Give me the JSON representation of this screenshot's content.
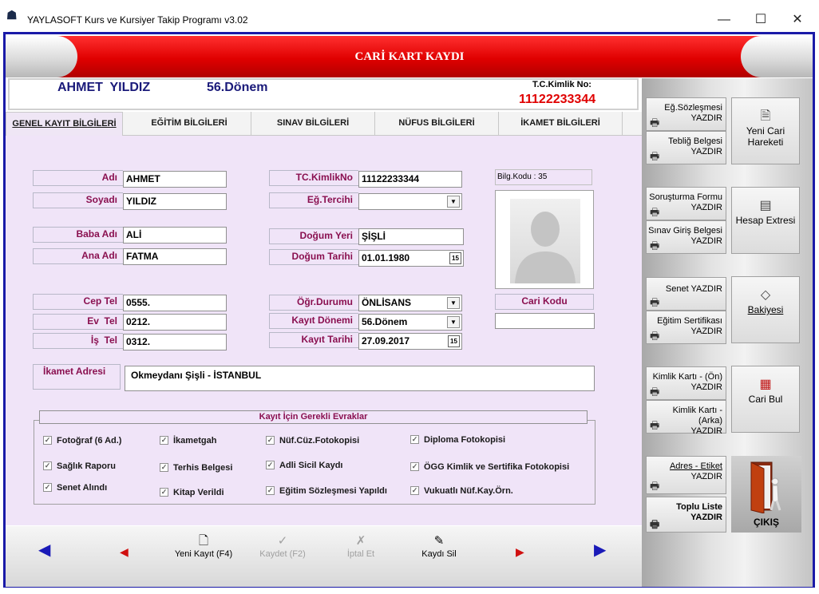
{
  "window": {
    "title": "YAYLASOFT Kurs ve Kursiyer Takip Programı v3.02",
    "minimize": "—",
    "maximize": "☐",
    "close": "✕"
  },
  "header": {
    "title": "CARİ KART KAYDI",
    "student_name": "AHMET  YILDIZ",
    "term": "56.Dönem",
    "tc_label": "T.C.Kimlik No:",
    "tc_value": "11122233344"
  },
  "tabs": [
    {
      "label": "GENEL KAYIT BİLGİLERİ"
    },
    {
      "label": "EĞİTİM BİLGİLERİ"
    },
    {
      "label": "SINAV BİLGİLERİ"
    },
    {
      "label": "NÜFUS BİLGİLERİ"
    },
    {
      "label": "İKAMET BİLGİLERİ"
    }
  ],
  "form": {
    "adi": {
      "label": "Adı",
      "value": "AHMET"
    },
    "soyadi": {
      "label": "Soyadı",
      "value": "YILDIZ"
    },
    "baba_adi": {
      "label": "Baba Adı",
      "value": "ALİ"
    },
    "ana_adi": {
      "label": "Ana Adı",
      "value": "FATMA"
    },
    "cep_tel": {
      "label": "Cep Tel",
      "value": "0555."
    },
    "ev_tel": {
      "label": "Ev  Tel",
      "value": "0212."
    },
    "is_tel": {
      "label": "İş  Tel",
      "value": "0312."
    },
    "tc_kimlik": {
      "label": "TC.KimlikNo",
      "value": "11122233344"
    },
    "eg_tercihi": {
      "label": "Eğ.Tercihi",
      "value": ""
    },
    "dogum_yeri": {
      "label": "Doğum Yeri",
      "value": "ŞİŞLİ"
    },
    "dogum_tarihi": {
      "label": "Doğum Tarihi",
      "value": "01.01.1980"
    },
    "ogr_durumu": {
      "label": "Öğr.Durumu",
      "value": "ÖNLİSANS"
    },
    "kayit_donemi": {
      "label": "Kayıt Dönemi",
      "value": "56.Dönem"
    },
    "kayit_tarihi": {
      "label": "Kayıt Tarihi",
      "value": "27.09.2017"
    },
    "bilg_kodu": "Bilg.Kodu : 35",
    "cari_kodu_label": "Cari Kodu",
    "cari_kodu_value": "",
    "adres_label": "İkamet Adresi",
    "adres_value": "Okmeydanı Şişli - İSTANBUL",
    "cal_glyph": "15"
  },
  "documents": {
    "title": "Kayıt İçin Gerekli Evraklar",
    "check_glyph": "✓",
    "items": [
      {
        "label": "Fotoğraf  (6 Ad.)",
        "checked": true
      },
      {
        "label": "İkametgah",
        "checked": true
      },
      {
        "label": "Nüf.Cüz.Fotokopisi",
        "checked": true
      },
      {
        "label": "Diploma Fotokopisi",
        "checked": true
      },
      {
        "label": "Sağlık Raporu",
        "checked": true
      },
      {
        "label": "Terhis Belgesi",
        "checked": true
      },
      {
        "label": "Adli Sicil Kaydı",
        "checked": true
      },
      {
        "label": "ÖGG Kimlik ve Sertifika Fotokopisi",
        "checked": true
      },
      {
        "label": "Senet Alındı",
        "checked": true
      },
      {
        "label": "Kitap Verildi",
        "checked": true
      },
      {
        "label": "Eğitim Sözleşmesi Yapıldı",
        "checked": true
      },
      {
        "label": "Vukuatlı Nüf.Kay.Örn.",
        "checked": true
      }
    ]
  },
  "toolbar": {
    "first": "◀",
    "prev": "◀",
    "next": "▶",
    "last": "▶",
    "new_label": "Yeni Kayıt (F4)",
    "save_label": "Kaydet (F2)",
    "cancel_label": "İptal Et",
    "delete_label": "Kaydı Sil",
    "new_icon": "🗋",
    "save_icon": "✓",
    "cancel_icon": "✗",
    "delete_icon": "✎"
  },
  "sidebar": {
    "print_glyph": "🖶",
    "buttons": [
      {
        "line1": "Eğ.Sözleşmesi",
        "line2": "YAZDIR"
      },
      {
        "line1": "Tebliğ Belgesi",
        "line2": "YAZDIR"
      },
      {
        "line1": "Soruşturma Formu",
        "line2": "YAZDIR"
      },
      {
        "line1": "Sınav Giriş Belgesi",
        "line2": "YAZDIR"
      },
      {
        "line1": "Senet YAZDIR",
        "line2": ""
      },
      {
        "line1": "Eğitim Sertifikası",
        "line2": "YAZDIR"
      },
      {
        "line1": "Kimlik Kartı - (Ön)",
        "line2": "YAZDIR"
      },
      {
        "line1": "Kimlik Kartı - (Arka)",
        "line2": "YAZDIR"
      },
      {
        "line1": "Adres - Etiket",
        "line2": "YAZDIR"
      },
      {
        "line1": "Toplu Liste",
        "line2": "YAZDIR"
      }
    ],
    "new_cari_movement": "Yeni Cari Hareketi",
    "account_statement": "Hesap Extresi",
    "balance": "Bakiyesi",
    "find_cari": "Cari Bul",
    "exit": "ÇIKIŞ",
    "new_cari_icon": "🗎",
    "statement_icon": "▤",
    "balance_icon": "◇",
    "find_icon": "▦"
  },
  "colors": {
    "accent_red": "#e00000",
    "frame_blue": "#1a1aa8",
    "label_color": "#8a1050",
    "panel_bg": "#f0e4f8",
    "nav_arrow_blue": "#1a1ab8",
    "nav_arrow_red": "#d01010"
  }
}
